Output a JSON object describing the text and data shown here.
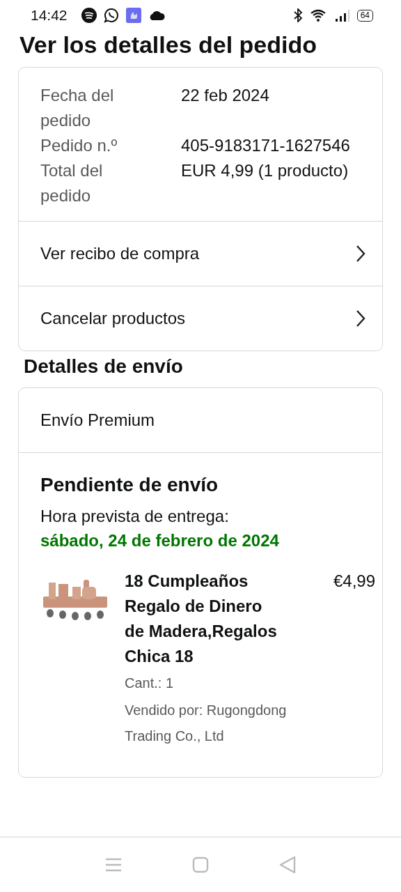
{
  "status_bar": {
    "time": "14:42",
    "battery": "64"
  },
  "title": "Ver los detalles del pedido",
  "order_summary": {
    "fields": [
      {
        "label": "Fecha del pedido",
        "value": "22 feb 2024"
      },
      {
        "label": "Pedido n.º",
        "value": "405-9183171-1627546"
      },
      {
        "label": "Total del pedido",
        "value": "EUR 4,99 (1 producto)"
      }
    ],
    "links": [
      "Ver recibo de compra",
      "Cancelar productos"
    ]
  },
  "shipping_heading": "Detalles de envío",
  "shipment": {
    "service": "Envío Premium",
    "status": "Pendiente de envío",
    "eta_label": "Hora prevista de entrega:",
    "eta_date": "sábado, 24 de febrero de 2024",
    "items": [
      {
        "title": "18 Cumpleaños Regalo de Dinero de Madera,Regalos Chica 18",
        "price": "€4,99",
        "quantity": "Cant.: 1",
        "seller": "Vendido por: Rugongdong Trading Co., Ltd"
      }
    ]
  }
}
